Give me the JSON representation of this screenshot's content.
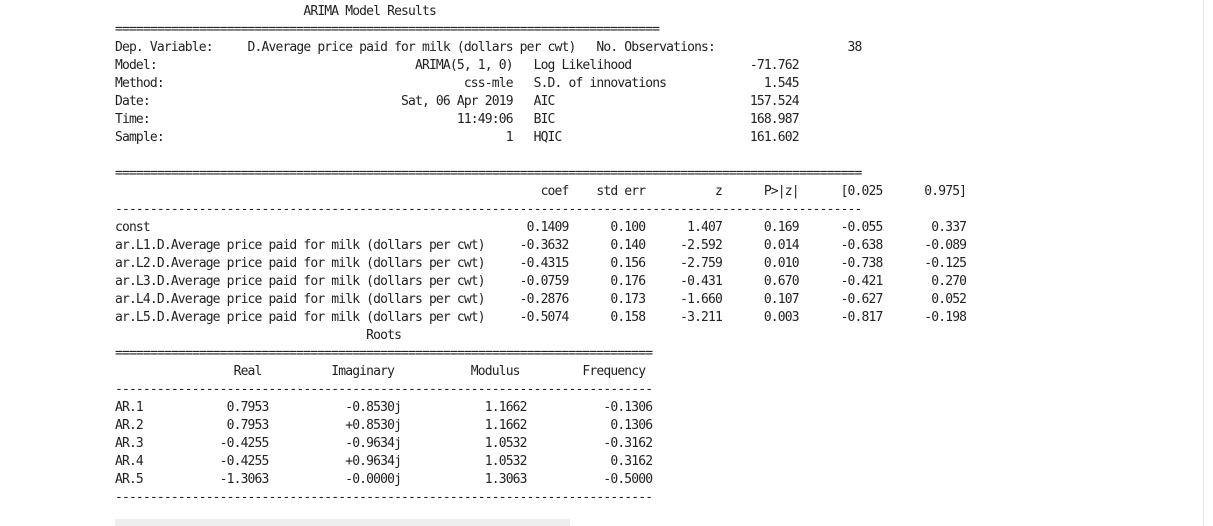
{
  "output_lines": [
    "                           ARIMA Model Results                              ",
    "==============================================================================",
    "Dep. Variable:     D.Average price paid for milk (dollars per cwt)   No. Observations:                   38",
    "Model:                                     ARIMA(5, 1, 0)   Log Likelihood                 -71.762",
    "Method:                                           css-mle   S.D. of innovations              1.545",
    "Date:                                    Sat, 06 Apr 2019   AIC                            157.524",
    "Time:                                            11:49:06   BIC                            168.987",
    "Sample:                                                 1   HQIC                           161.602",
    "",
    "===========================================================================================================",
    "                                                             coef    std err          z      P>|z|      [0.025      0.975]",
    "-----------------------------------------------------------------------------------------------------------",
    "const                                                      0.1409      0.100      1.407      0.169      -0.055       0.337",
    "ar.L1.D.Average price paid for milk (dollars per cwt)     -0.3632      0.140     -2.592      0.014      -0.638      -0.089",
    "ar.L2.D.Average price paid for milk (dollars per cwt)     -0.4315      0.156     -2.759      0.010      -0.738      -0.125",
    "ar.L3.D.Average price paid for milk (dollars per cwt)     -0.0759      0.176     -0.431      0.670      -0.421       0.270",
    "ar.L4.D.Average price paid for milk (dollars per cwt)     -0.2876      0.173     -1.660      0.107      -0.627       0.052",
    "ar.L5.D.Average price paid for milk (dollars per cwt)     -0.5074      0.158     -3.211      0.003      -0.817      -0.198",
    "                                    Roots                                    ",
    "=============================================================================",
    "                 Real          Imaginary           Modulus         Frequency",
    "-----------------------------------------------------------------------------",
    "AR.1            0.7953           -0.8530j            1.1662           -0.1306",
    "AR.2            0.7953           +0.8530j            1.1662            0.1306",
    "AR.3           -0.4255           -0.9634j            1.0532           -0.3162",
    "AR.4           -0.4255           +0.9634j            1.0532            0.3162",
    "AR.5           -1.3063           -0.0000j            1.3063           -0.5000",
    "-----------------------------------------------------------------------------"
  ]
}
